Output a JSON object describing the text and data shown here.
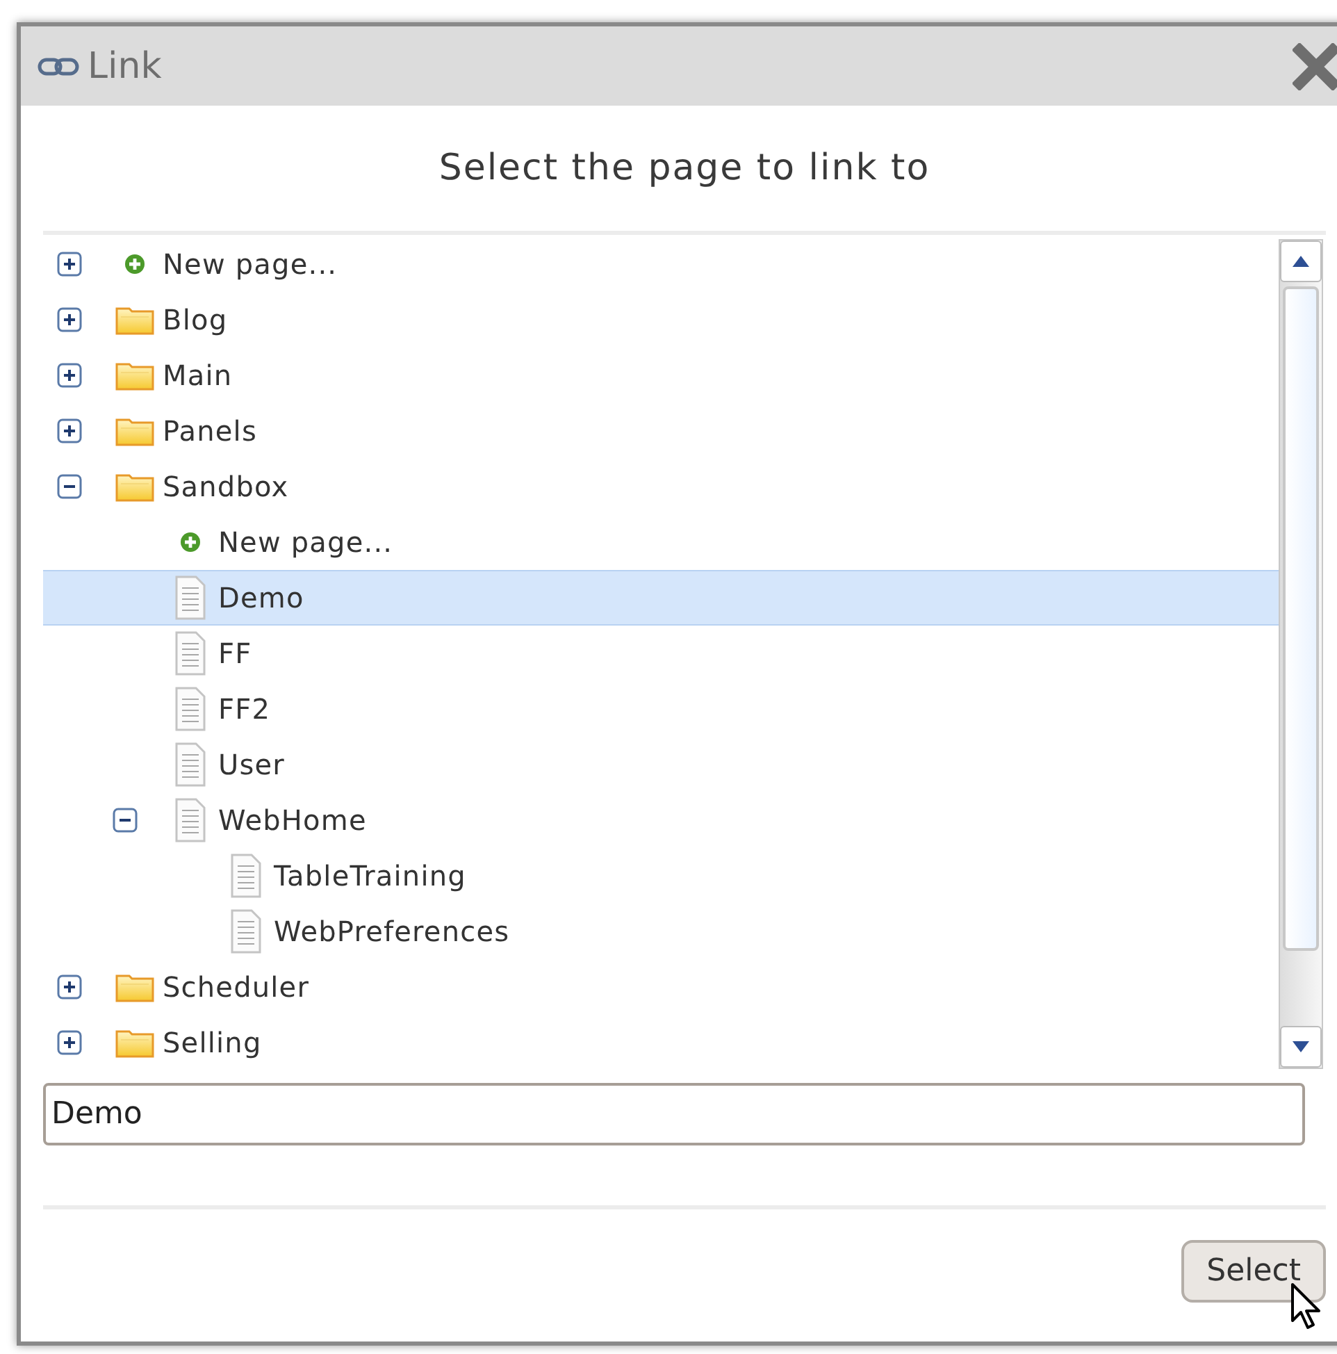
{
  "window": {
    "title": "Link"
  },
  "heading": "Select the page to link to",
  "tree": [
    {
      "label": "New page...",
      "kind": "new",
      "expanded": false,
      "selected": false
    },
    {
      "label": "Blog",
      "kind": "folder",
      "expanded": false,
      "selected": false
    },
    {
      "label": "Main",
      "kind": "folder",
      "expanded": false,
      "selected": false
    },
    {
      "label": "Panels",
      "kind": "folder",
      "expanded": false,
      "selected": false
    },
    {
      "label": "Sandbox",
      "kind": "folder",
      "expanded": true,
      "selected": false,
      "children": [
        {
          "label": "New page...",
          "kind": "new",
          "selected": false
        },
        {
          "label": "Demo",
          "kind": "page",
          "selected": true
        },
        {
          "label": "FF",
          "kind": "page",
          "selected": false
        },
        {
          "label": "FF2",
          "kind": "page",
          "selected": false
        },
        {
          "label": "User",
          "kind": "page",
          "selected": false
        },
        {
          "label": "WebHome",
          "kind": "page",
          "expanded": true,
          "selected": false,
          "children": [
            {
              "label": "TableTraining",
              "kind": "page",
              "selected": false
            },
            {
              "label": "WebPreferences",
              "kind": "page",
              "selected": false
            }
          ]
        }
      ]
    },
    {
      "label": "Scheduler",
      "kind": "folder",
      "expanded": false,
      "selected": false
    },
    {
      "label": "Selling",
      "kind": "folder",
      "expanded": false,
      "selected": false
    }
  ],
  "page_field": {
    "value": "Demo"
  },
  "buttons": [
    "Select"
  ]
}
